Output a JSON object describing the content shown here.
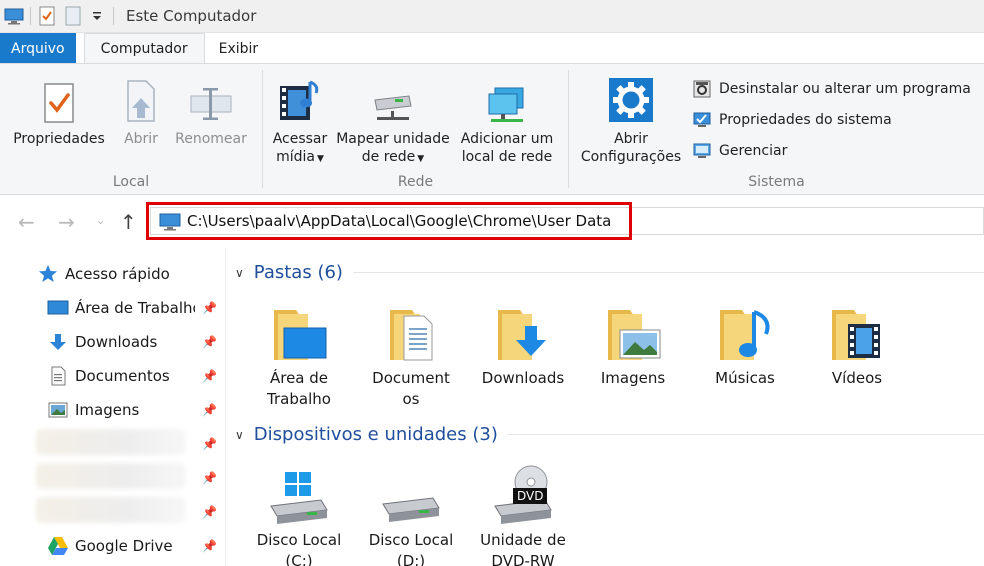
{
  "window": {
    "title": "Este Computador"
  },
  "ribbon_tabs": [
    "Arquivo",
    "Computador",
    "Exibir"
  ],
  "ribbon": {
    "groups": [
      {
        "label": "Local",
        "buttons": [
          "Propriedades",
          "Abrir",
          "Renomear"
        ]
      },
      {
        "label": "Rede",
        "buttons": [
          "Acessar mídia",
          "Mapear unidade de rede",
          "Adicionar um local de rede"
        ]
      },
      {
        "label": "Sistema"
      }
    ],
    "acessar": {
      "line1": "Acessar",
      "line2": "mídia"
    },
    "mapear": {
      "line1": "Mapear unidade",
      "line2": "de rede"
    },
    "adicionar": {
      "line1": "Adicionar um",
      "line2": "local de rede"
    },
    "abrir_config": {
      "line1": "Abrir",
      "line2": "Configurações"
    },
    "sistema_small": [
      "Desinstalar ou alterar um programa",
      "Propriedades do sistema",
      "Gerenciar"
    ]
  },
  "address": {
    "path": "C:\\Users\\paalv\\AppData\\Local\\Google\\Chrome\\User Data"
  },
  "sidebar": {
    "items": [
      {
        "label": "Acesso rápido",
        "icon": "star-icon"
      },
      {
        "label": "Área de Trabalho",
        "icon": "desktop-icon"
      },
      {
        "label": "Downloads",
        "icon": "download-arrow-icon"
      },
      {
        "label": "Documentos",
        "icon": "document-icon"
      },
      {
        "label": "Imagens",
        "icon": "image-icon"
      },
      {
        "label": "Google Drive",
        "icon": "google-drive-icon"
      }
    ]
  },
  "sections": {
    "pastas": {
      "title": "Pastas (6)"
    },
    "dispositivos": {
      "title": "Dispositivos e unidades (3)"
    }
  },
  "folders": [
    {
      "line1": "Área de",
      "line2": "Trabalho"
    },
    {
      "line1": "Document",
      "line2": "os"
    },
    {
      "line1": "Downloads",
      "line2": ""
    },
    {
      "line1": "Imagens",
      "line2": ""
    },
    {
      "line1": "Músicas",
      "line2": ""
    },
    {
      "line1": "Vídeos",
      "line2": ""
    }
  ],
  "drives": [
    {
      "line1": "Disco Local",
      "line2": "(C:)"
    },
    {
      "line1": "Disco Local",
      "line2": "(D:)"
    },
    {
      "line1": "Unidade de",
      "line2": "DVD-RW"
    }
  ],
  "dvd_badge": "DVD",
  "colors": {
    "accent": "#1979ca",
    "highlight": "#e10000",
    "folder": "#f3cf6b",
    "link": "#1e4e9c"
  }
}
